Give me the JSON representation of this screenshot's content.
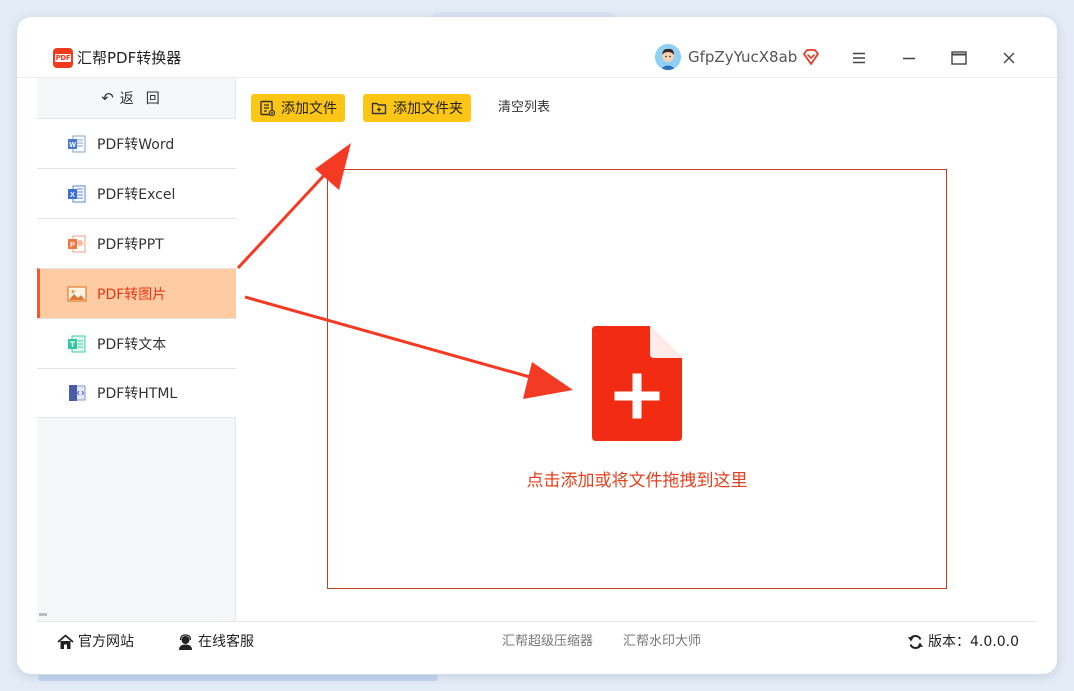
{
  "app": {
    "title": "汇帮PDF转换器",
    "logo_text": "PDF",
    "username": "GfpZyYucX8ab"
  },
  "window_controls": {
    "menu_icon": "hamburger-icon",
    "minimize_icon": "minimize-icon",
    "maximize_icon": "maximize-icon",
    "close_icon": "close-icon"
  },
  "sidebar": {
    "back_label": "返回",
    "items": [
      {
        "label": "PDF转Word",
        "icon": "word-icon",
        "active": false
      },
      {
        "label": "PDF转Excel",
        "icon": "excel-icon",
        "active": false
      },
      {
        "label": "PDF转PPT",
        "icon": "ppt-icon",
        "active": false
      },
      {
        "label": "PDF转图片",
        "icon": "image-icon",
        "active": true
      },
      {
        "label": "PDF转文本",
        "icon": "text-icon",
        "active": false
      },
      {
        "label": "PDF转HTML",
        "icon": "html-icon",
        "active": false
      }
    ]
  },
  "toolbar": {
    "add_file": "添加文件",
    "add_folder": "添加文件夹",
    "clear_list": "清空列表"
  },
  "dropzone": {
    "hint": "点击添加或将文件拖拽到这里"
  },
  "footer": {
    "website": "官方网站",
    "support": "在线客服",
    "link1": "汇帮超级压缩器",
    "link2": "汇帮水印大师",
    "version": "版本：4.0.0.0"
  },
  "colors": {
    "accent": "#fdc516",
    "brand_red": "#f23a1c",
    "active_bg": "#fecba3",
    "annotation_arrow": "#f53a24"
  }
}
